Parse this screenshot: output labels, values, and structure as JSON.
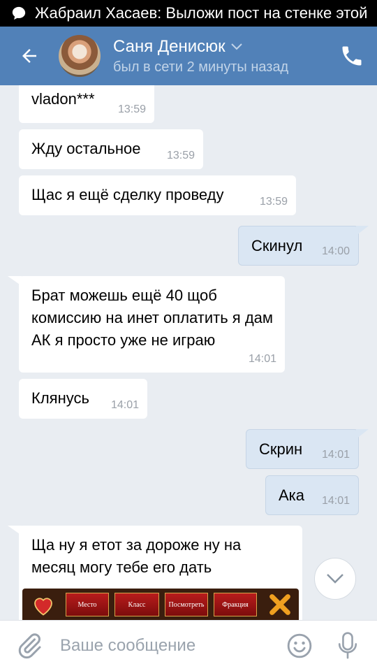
{
  "notification": {
    "text": "Жабраил Хасаев: Выложи пост на стенке этой"
  },
  "header": {
    "name": "Саня Денисюк",
    "status": "был в сети 2 минуты назад"
  },
  "messages": [
    {
      "dir": "in",
      "text": "vladon***",
      "time": "13:59"
    },
    {
      "dir": "in",
      "text": "Жду остальное",
      "time": "13:59"
    },
    {
      "dir": "in",
      "text": "Щас я ещё сделку проведу",
      "time": "13:59"
    },
    {
      "dir": "out",
      "text": "Скинул",
      "time": "14:00"
    },
    {
      "dir": "in",
      "text": "Брат можешь ещё 40 щоб комиссию на инет оплатить я дам АК я просто уже не играю",
      "time": "14:01"
    },
    {
      "dir": "in",
      "text": "Клянусь",
      "time": "14:01"
    },
    {
      "dir": "out",
      "text": "Скрин",
      "time": "14:01"
    },
    {
      "dir": "out",
      "text": "Ака",
      "time": "14:01"
    },
    {
      "dir": "in",
      "text": "Ща ну я етот за дороже ну на месяц могу тебе его дать",
      "time": ""
    }
  ],
  "attachment": {
    "cells": [
      "Место",
      "Класс",
      "Посмотреть",
      "Фракция"
    ]
  },
  "input": {
    "placeholder": "Ваше сообщение"
  },
  "colors": {
    "header": "#5181b8",
    "background": "#e9edf2",
    "outgoing": "#dae6f3",
    "incoming": "#ffffff"
  }
}
